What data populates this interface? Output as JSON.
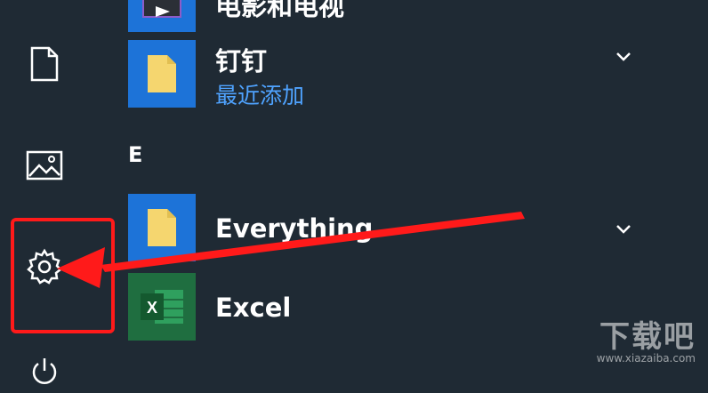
{
  "apps": [
    {
      "name": "电影和电视",
      "icon": "movies-tv-icon"
    },
    {
      "name": "钉钉",
      "subtitle": "最近添加",
      "icon": "folder-icon",
      "expandable": true
    },
    {
      "name": "Everything",
      "icon": "folder-icon",
      "expandable": true
    },
    {
      "name": "Excel",
      "icon": "excel-icon",
      "icon_letter": "X"
    }
  ],
  "section_letter": "E",
  "rail": {
    "items": [
      {
        "name": "documents-icon"
      },
      {
        "name": "pictures-icon"
      },
      {
        "name": "settings-icon"
      },
      {
        "name": "power-icon"
      }
    ]
  },
  "annotation": {
    "color": "#ff1a1a",
    "target": "settings-icon"
  },
  "watermark": {
    "main": "下载吧",
    "url": "www.xiazaiba.com"
  },
  "colors": {
    "background": "#1f2a34",
    "tile_blue": "#1d73d8",
    "tile_green": "#1f6e40",
    "link_blue": "#4fa3ff",
    "folder_yellow": "#f5d66f"
  }
}
